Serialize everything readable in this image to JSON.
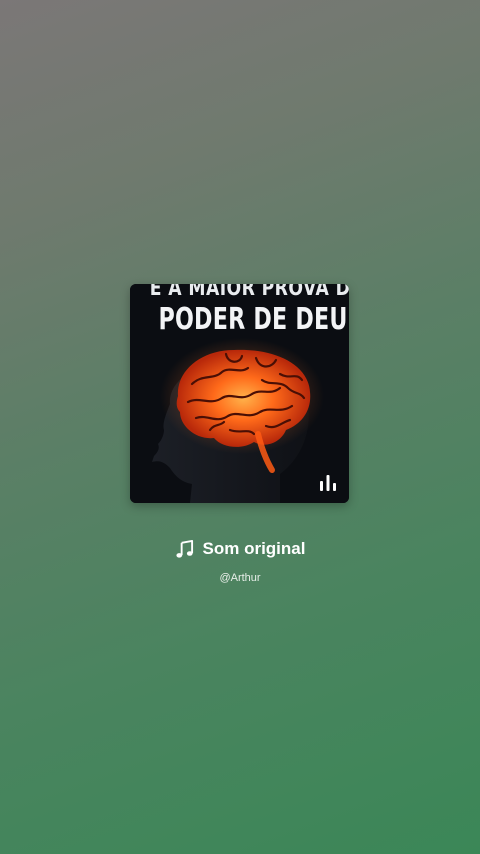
{
  "cover": {
    "headline_line1": "É A MAIOR PROVA DO",
    "headline_line2": "PODER DE DEUS"
  },
  "sound": {
    "title": "Som original",
    "author": "@Arthur",
    "icon": "music-note-icon"
  },
  "icons": {
    "cover_indicator": "audio-bars-icon"
  },
  "colors": {
    "background_top": "#7b7777",
    "background_bottom": "#3b8757",
    "brain_glow": "#ff6a1a"
  }
}
